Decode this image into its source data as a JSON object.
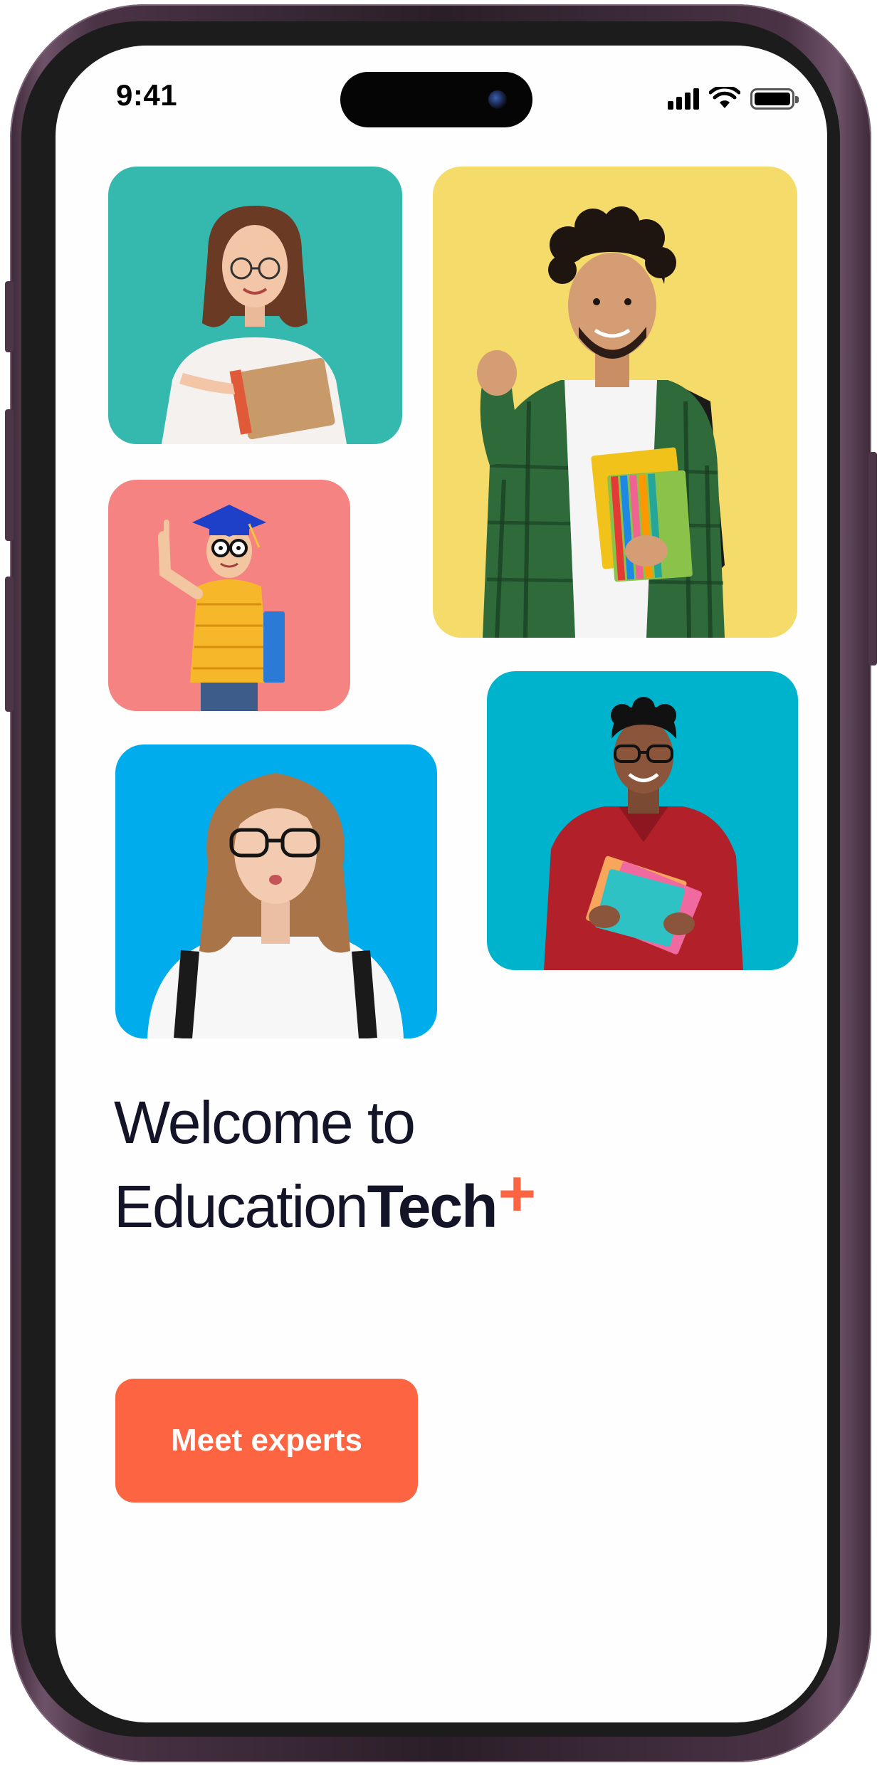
{
  "status_bar": {
    "time": "9:41",
    "icons": [
      "cellular-signal-icon",
      "wifi-icon",
      "battery-icon"
    ]
  },
  "photo_tiles": [
    {
      "subject": "student-woman-with-notebooks",
      "bg_color": "#35b9ae"
    },
    {
      "subject": "student-man-with-backpack",
      "bg_color": "#f5dc6a"
    },
    {
      "subject": "child-graduate-with-book",
      "bg_color": "#f48382"
    },
    {
      "subject": "student-man-with-notebooks",
      "bg_color": "#00b3cc"
    },
    {
      "subject": "student-woman-with-glasses",
      "bg_color": "#01acec"
    }
  ],
  "welcome": {
    "line1": "Welcome to",
    "brand_part1": "Education",
    "brand_part2": "Tech",
    "brand_plus": "+"
  },
  "cta": {
    "label": "Meet experts"
  },
  "colors": {
    "accent": "#fc6442",
    "text_dark": "#141428",
    "frame": "#4a3345"
  }
}
